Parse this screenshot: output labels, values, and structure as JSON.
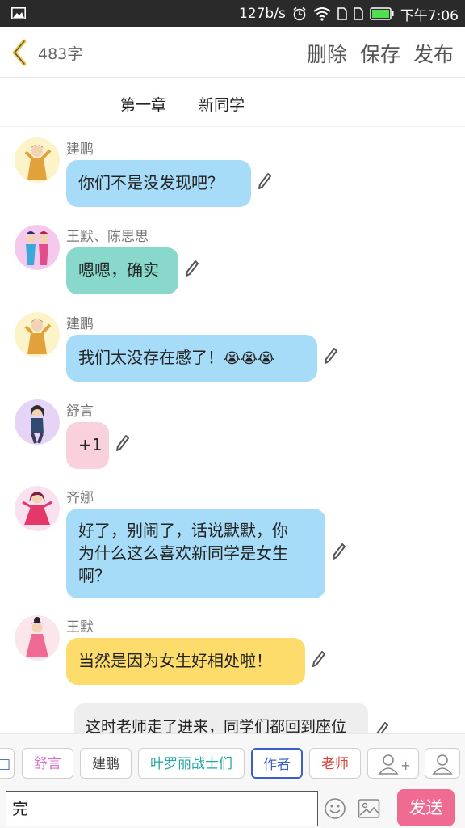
{
  "status_bar": {
    "speed": "127b/s",
    "time": "下午7:06"
  },
  "header": {
    "word_count": "483字",
    "actions": {
      "delete": "删除",
      "save": "保存",
      "publish": "发布"
    }
  },
  "chapter": {
    "number": "第一章",
    "title": "新同学"
  },
  "messages": [
    {
      "sender": "建鹏",
      "text": "你们不是没发现吧？",
      "bubble_color": "#a6dcf7"
    },
    {
      "sender": "王默、陈思思",
      "text": "嗯嗯，确实",
      "bubble_color": "#88d8cb"
    },
    {
      "sender": "建鹏",
      "text": "我们太没存在感了！",
      "emoji": "😭😭😭",
      "bubble_color": "#a6dcf7"
    },
    {
      "sender": "舒言",
      "text": "+1",
      "bubble_color": "#f9d1dd"
    },
    {
      "sender": "齐娜",
      "text_line1": "好了，别闹了，话说默默，你",
      "text_line2": "为什么这么喜欢新同学是女生",
      "text_line3": "啊？",
      "bubble_color": "#a6dcf7"
    },
    {
      "sender": "王默",
      "text": "当然是因为女生好相处啦！",
      "bubble_color": "#fddc6c"
    }
  ],
  "narration": "这时老师走了进来，同学们都回到座位",
  "chips": {
    "partial": "□",
    "items": [
      {
        "label": "舒言",
        "color": "#d56fd0"
      },
      {
        "label": "建鹏",
        "color": "#444444"
      },
      {
        "label": "叶罗丽战士们",
        "color": "#2aa6a0"
      },
      {
        "label": "作者",
        "color": "#3d5fc9"
      },
      {
        "label": "老师",
        "color": "#d9433b"
      }
    ],
    "add_character_label": "+"
  },
  "input": {
    "value": "完"
  },
  "send_label": "发送",
  "colors": {
    "accent_yellow": "#f2c94c",
    "send_pink": "#f06b92"
  },
  "icons": [
    "image-icon",
    "alarm-icon",
    "wifi-icon",
    "sim-icon",
    "battery-icon",
    "back-chevron-icon",
    "pencil-icon",
    "emoji-icon",
    "picture-icon",
    "add-person-icon",
    "person-icon"
  ]
}
